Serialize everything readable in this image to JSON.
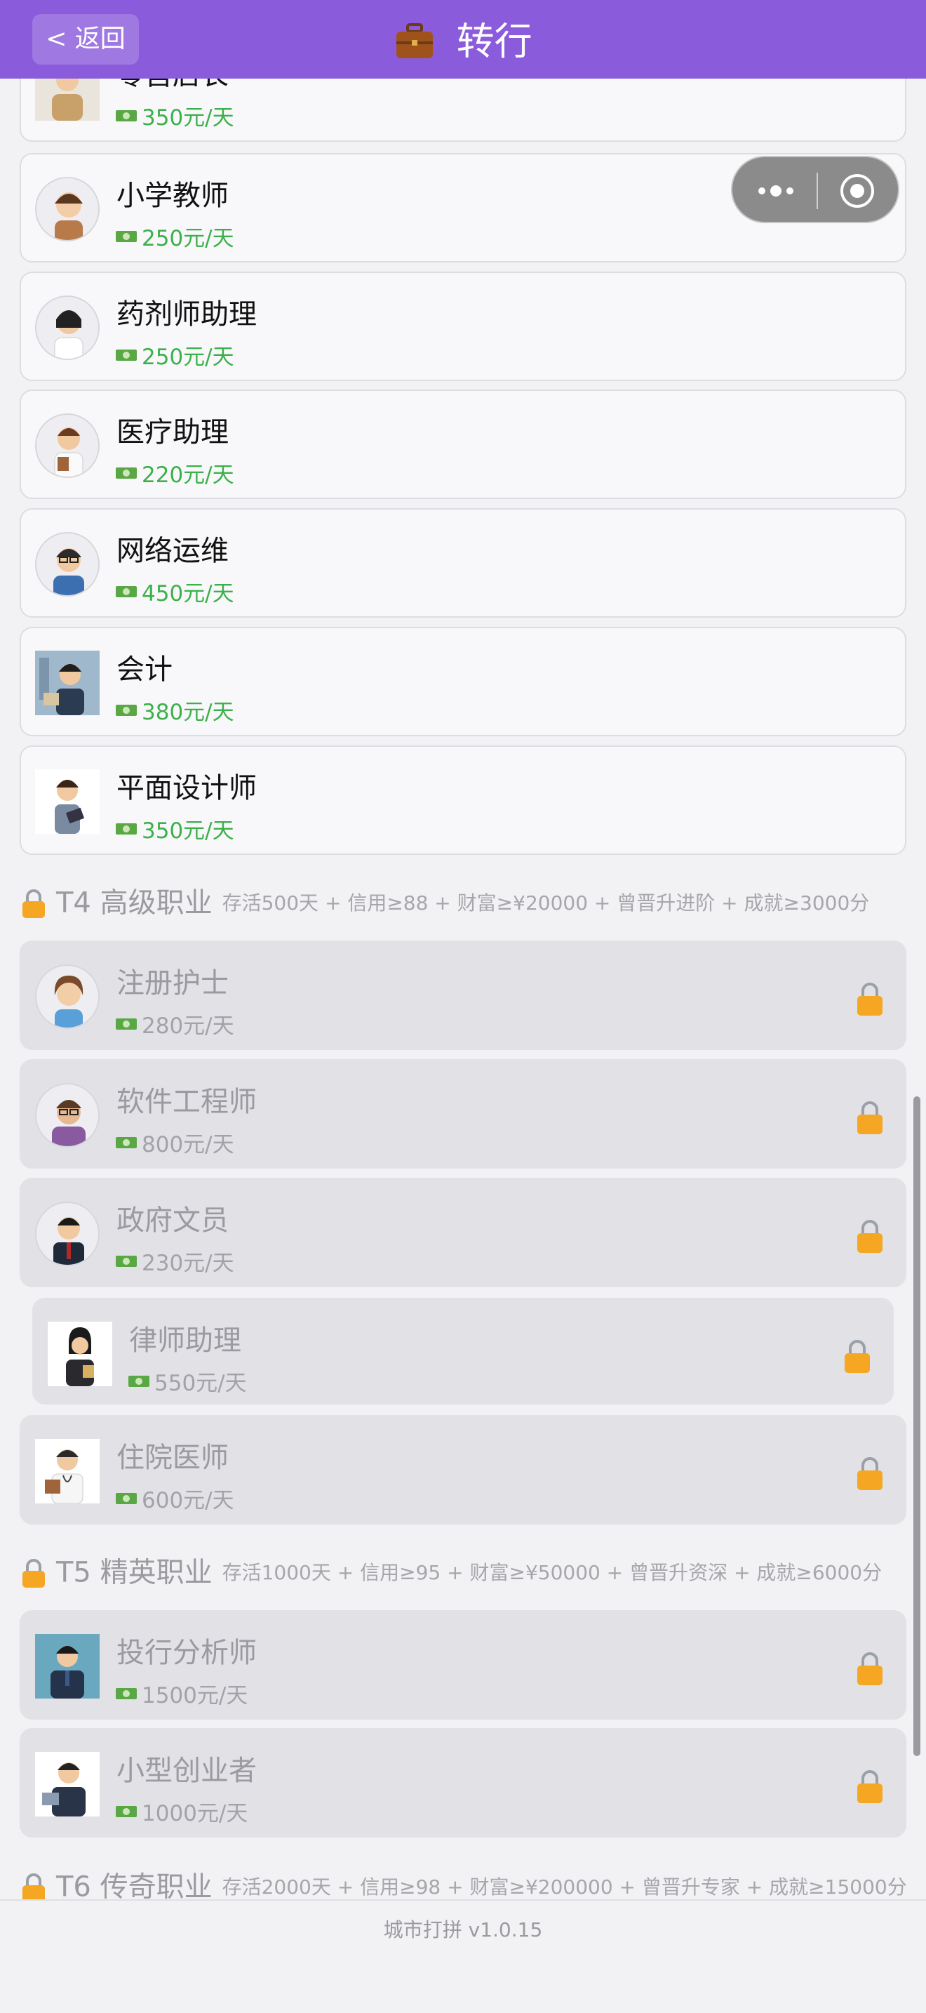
{
  "header": {
    "back_label": "< 返回",
    "title": "转行",
    "background": "#8a5bdb"
  },
  "jobs_unlocked": [
    {
      "name": "零售店长",
      "salary": "350元/天",
      "avatar_icon": "shopkeeper-avatar-icon"
    },
    {
      "name": "小学教师",
      "salary": "250元/天",
      "avatar_icon": "teacher-avatar-icon"
    },
    {
      "name": "药剂师助理",
      "salary": "250元/天",
      "avatar_icon": "pharmacist-avatar-icon"
    },
    {
      "name": "医疗助理",
      "salary": "220元/天",
      "avatar_icon": "medical-assistant-avatar-icon"
    },
    {
      "name": "网络运维",
      "salary": "450元/天",
      "avatar_icon": "network-ops-avatar-icon"
    },
    {
      "name": "会计",
      "salary": "380元/天",
      "avatar_icon": "accountant-avatar-icon"
    },
    {
      "name": "平面设计师",
      "salary": "350元/天",
      "avatar_icon": "designer-avatar-icon"
    }
  ],
  "tiers": [
    {
      "tier": "T4 高级职业",
      "requirements": "存活500天 + 信用≥88 + 财富≥¥20000 + 曾晋升进阶 + 成就≥3000分",
      "jobs": [
        {
          "name": "注册护士",
          "salary": "280元/天"
        },
        {
          "name": "软件工程师",
          "salary": "800元/天"
        },
        {
          "name": "政府文员",
          "salary": "230元/天"
        },
        {
          "name": "律师助理",
          "salary": "550元/天"
        },
        {
          "name": "住院医师",
          "salary": "600元/天"
        }
      ]
    },
    {
      "tier": "T5 精英职业",
      "requirements": "存活1000天 + 信用≥95 + 财富≥¥50000 + 曾晋升资深 + 成就≥6000分",
      "jobs": [
        {
          "name": "投行分析师",
          "salary": "1500元/天"
        },
        {
          "name": "小型创业者",
          "salary": "1000元/天"
        }
      ]
    },
    {
      "tier": "T6 传奇职业",
      "requirements": "存活2000天 + 信用≥98 + 财富≥¥200000 + 曾晋升专家 + 成就≥15000分",
      "jobs": []
    }
  ],
  "footer": {
    "version": "城市打拼 v1.0.15"
  },
  "colors": {
    "salary_green": "#3cb04a",
    "lock_orange": "#f5a623",
    "locked_card": "#e1e1e6"
  }
}
